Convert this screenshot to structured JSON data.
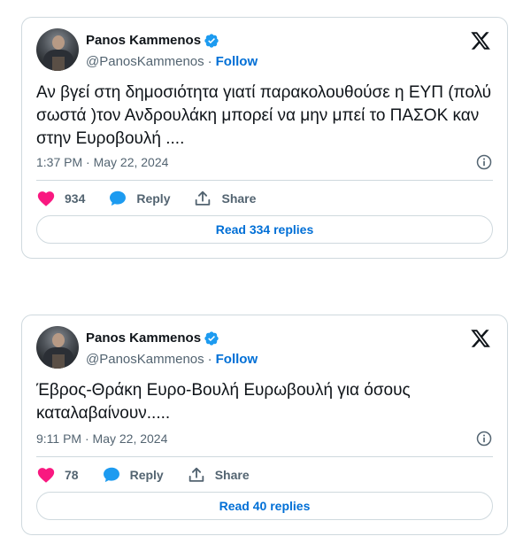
{
  "tweets": [
    {
      "author_name": "Panos Kammenos",
      "handle": "@PanosKammenos",
      "follow_label": "Follow",
      "separator": "·",
      "text": "Αν βγεί στη δημοσιότητα γιατί παρακολουθούσε η ΕΥΠ (πολύ σωστά )τον Ανδρουλάκη μπορεί να μην μπεί το ΠΑΣΟΚ καν στην Ευροβουλή ....",
      "timestamp": "1:37 PM · May 22, 2024",
      "likes": "934",
      "reply_label": "Reply",
      "share_label": "Share",
      "read_replies_label": "Read 334 replies"
    },
    {
      "author_name": "Panos Kammenos",
      "handle": "@PanosKammenos",
      "follow_label": "Follow",
      "separator": "·",
      "text": "Έβρος-Θράκη Ευρο-Βουλή Ευρωβουλή για όσους καταλαβαίνουν.....",
      "timestamp": "9:11 PM · May 22, 2024",
      "likes": "78",
      "reply_label": "Reply",
      "share_label": "Share",
      "read_replies_label": "Read 40 replies"
    }
  ],
  "icons": {
    "verified": "verified-badge-icon",
    "platform_logo": "x-logo-icon",
    "info": "info-icon",
    "like": "heart-icon",
    "reply": "reply-bubble-icon",
    "share": "share-upload-icon"
  },
  "colors": {
    "like": "#f91880",
    "reply": "#1d9bf0",
    "verified": "#1d9bf0",
    "link": "#006fd6",
    "muted": "#536471",
    "border": "#cfd9de"
  }
}
